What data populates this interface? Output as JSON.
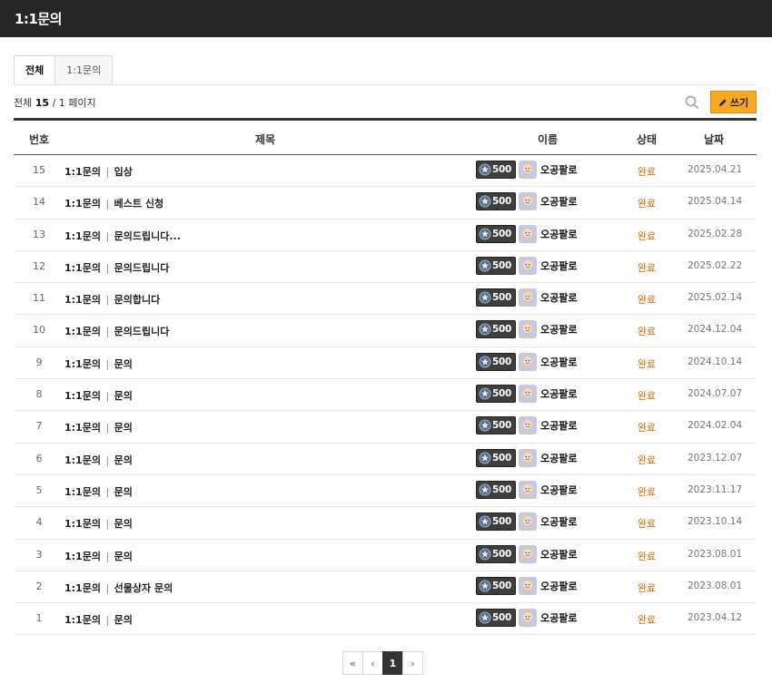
{
  "header": {
    "title": "1:1문의"
  },
  "tabs": [
    {
      "label": "전체",
      "active": true
    },
    {
      "label": "1:1문의",
      "active": false
    }
  ],
  "summary": {
    "prefix": "전체",
    "total": "15",
    "pages": "/ 1 페이지"
  },
  "toolbar": {
    "search_icon": "search-icon",
    "write_label": "쓰기",
    "write_icon": "pencil-icon",
    "accent": "#f7a823"
  },
  "columns": {
    "num": "번호",
    "title": "제목",
    "name": "이름",
    "status": "상태",
    "date": "날짜"
  },
  "rows": [
    {
      "num": "15",
      "category": "1:1문의",
      "subject": "입상",
      "badge": "500",
      "name": "오공팔로",
      "status": "완료",
      "date": "2025.04.21"
    },
    {
      "num": "14",
      "category": "1:1문의",
      "subject": "베스트 신청",
      "badge": "500",
      "name": "오공팔로",
      "status": "완료",
      "date": "2025.04.14"
    },
    {
      "num": "13",
      "category": "1:1문의",
      "subject": "문의드립니다...",
      "badge": "500",
      "name": "오공팔로",
      "status": "완료",
      "date": "2025.02.28"
    },
    {
      "num": "12",
      "category": "1:1문의",
      "subject": "문의드립니다",
      "badge": "500",
      "name": "오공팔로",
      "status": "완료",
      "date": "2025.02.22"
    },
    {
      "num": "11",
      "category": "1:1문의",
      "subject": "문의합니다",
      "badge": "500",
      "name": "오공팔로",
      "status": "완료",
      "date": "2025.02.14"
    },
    {
      "num": "10",
      "category": "1:1문의",
      "subject": "문의드립니다",
      "badge": "500",
      "name": "오공팔로",
      "status": "완료",
      "date": "2024.12.04"
    },
    {
      "num": "9",
      "category": "1:1문의",
      "subject": "문의",
      "badge": "500",
      "name": "오공팔로",
      "status": "완료",
      "date": "2024.10.14"
    },
    {
      "num": "8",
      "category": "1:1문의",
      "subject": "문의",
      "badge": "500",
      "name": "오공팔로",
      "status": "완료",
      "date": "2024.07.07"
    },
    {
      "num": "7",
      "category": "1:1문의",
      "subject": "문의",
      "badge": "500",
      "name": "오공팔로",
      "status": "완료",
      "date": "2024.02.04"
    },
    {
      "num": "6",
      "category": "1:1문의",
      "subject": "문의",
      "badge": "500",
      "name": "오공팔로",
      "status": "완료",
      "date": "2023.12.07"
    },
    {
      "num": "5",
      "category": "1:1문의",
      "subject": "문의",
      "badge": "500",
      "name": "오공팔로",
      "status": "완료",
      "date": "2023.11.17"
    },
    {
      "num": "4",
      "category": "1:1문의",
      "subject": "문의",
      "badge": "500",
      "name": "오공팔로",
      "status": "완료",
      "date": "2023.10.14"
    },
    {
      "num": "3",
      "category": "1:1문의",
      "subject": "문의",
      "badge": "500",
      "name": "오공팔로",
      "status": "완료",
      "date": "2023.08.01"
    },
    {
      "num": "2",
      "category": "1:1문의",
      "subject": "선물상자 문의",
      "badge": "500",
      "name": "오공팔로",
      "status": "완료",
      "date": "2023.08.01"
    },
    {
      "num": "1",
      "category": "1:1문의",
      "subject": "문의",
      "badge": "500",
      "name": "오공팔로",
      "status": "완료",
      "date": "2023.04.12"
    }
  ],
  "pagination": {
    "first": "«",
    "prev": "‹",
    "current": "1",
    "next": "›"
  }
}
